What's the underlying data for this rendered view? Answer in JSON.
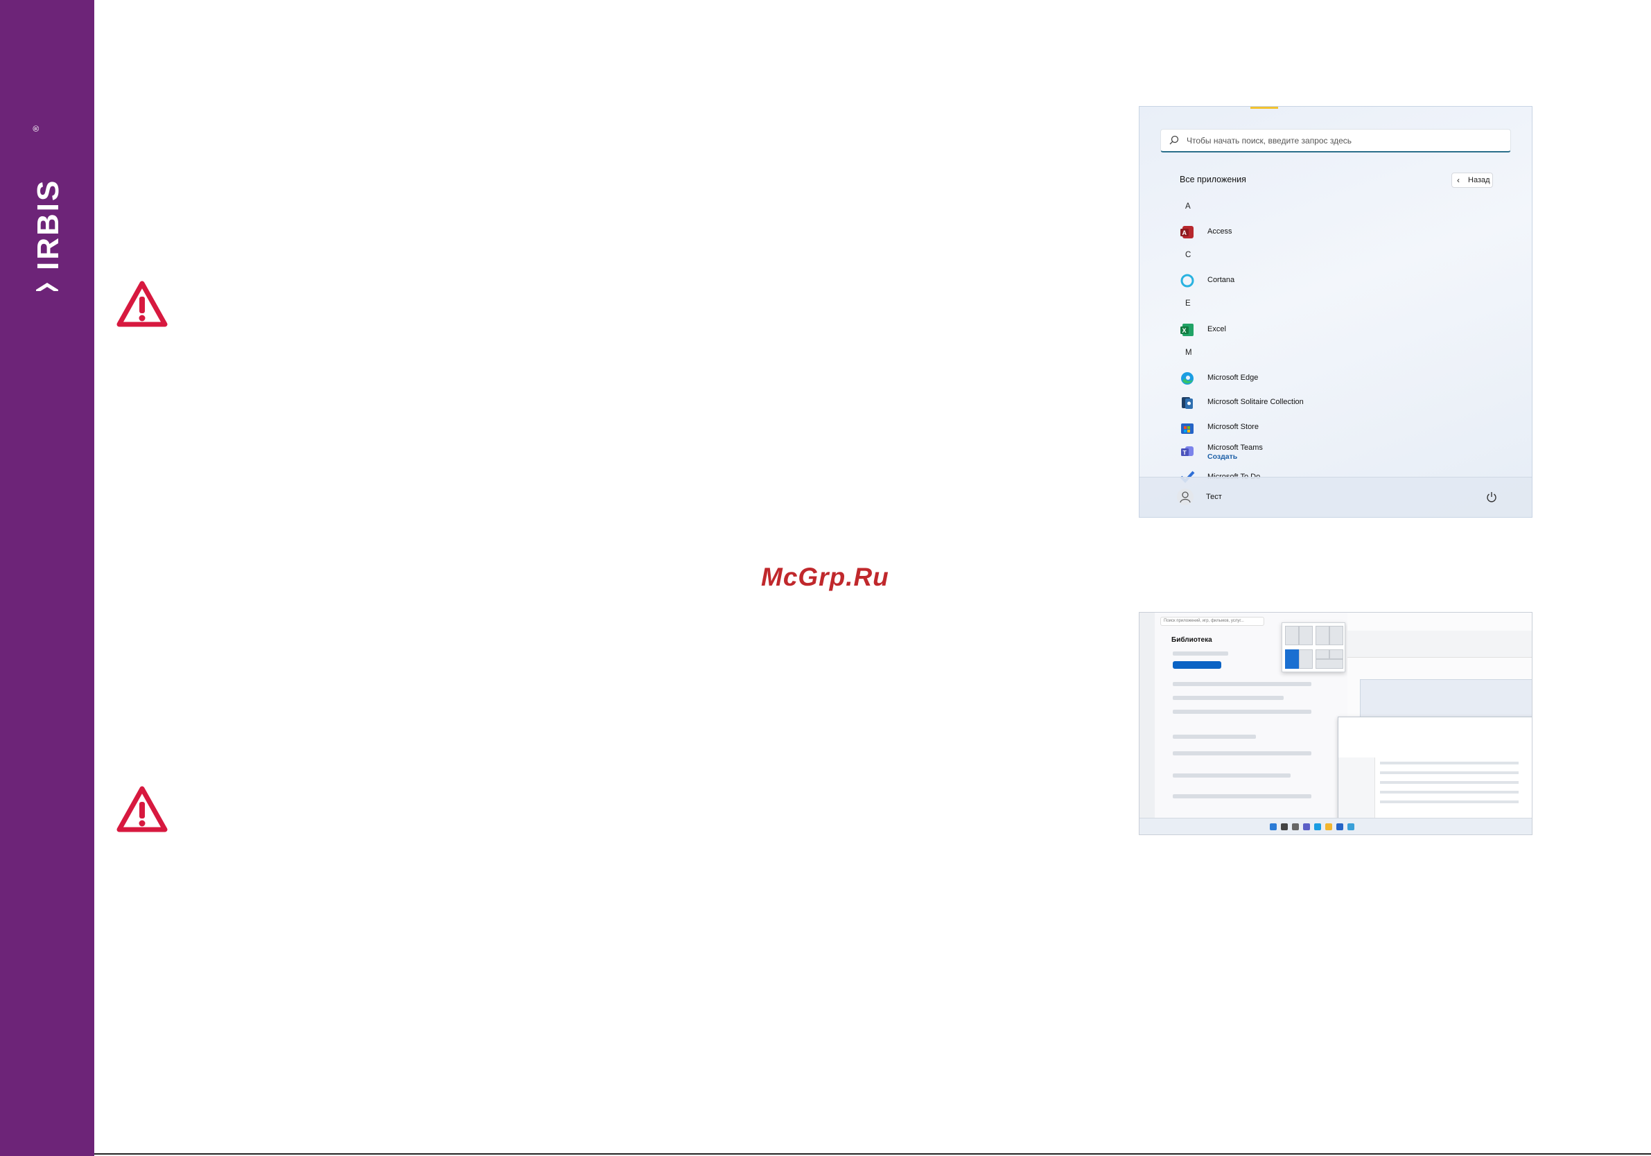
{
  "brand": {
    "logo_text": "IRBIS",
    "registered": "®"
  },
  "watermark": "McGrp.Ru",
  "start_menu": {
    "search_placeholder": "Чтобы начать поиск, введите запрос здесь",
    "all_apps_label": "Все приложения",
    "back_label": "Назад",
    "sections": [
      {
        "letter": "A",
        "apps": [
          {
            "name": "Access",
            "icon": "access-icon"
          }
        ]
      },
      {
        "letter": "C",
        "apps": [
          {
            "name": "Cortana",
            "icon": "cortana-icon"
          }
        ]
      },
      {
        "letter": "E",
        "apps": [
          {
            "name": "Excel",
            "icon": "excel-icon"
          }
        ]
      },
      {
        "letter": "M",
        "apps": [
          {
            "name": "Microsoft Edge",
            "icon": "edge-icon"
          },
          {
            "name": "Microsoft Solitaire Collection",
            "icon": "solitaire-icon"
          },
          {
            "name": "Microsoft Store",
            "icon": "store-icon"
          },
          {
            "name": "Microsoft Teams",
            "sub": "Создать",
            "icon": "teams-icon"
          },
          {
            "name": "Microsoft To Do",
            "icon": "todo-icon"
          }
        ]
      }
    ],
    "user_name": "Тест"
  },
  "desktop_screenshot": {
    "store_search": "Поиск приложений, игр, фильмов, услуг...",
    "library_title": "Библиотека"
  },
  "colors": {
    "sidebar": "#6d2478",
    "warning": "#d7193f",
    "watermark": "#c0282c"
  }
}
